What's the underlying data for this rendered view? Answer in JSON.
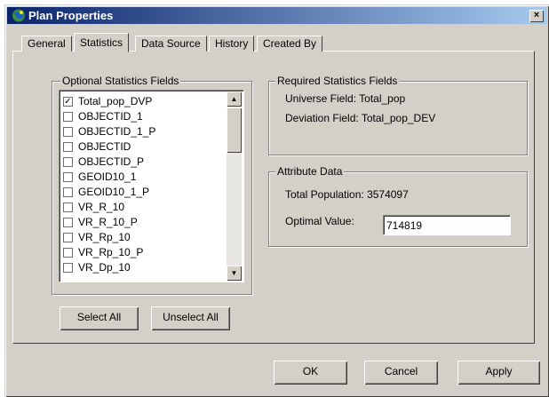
{
  "window": {
    "title": "Plan Properties",
    "close_glyph": "×"
  },
  "tabs": [
    {
      "label": "General"
    },
    {
      "label": "Statistics",
      "active": true
    },
    {
      "label": "Data Source"
    },
    {
      "label": "History"
    },
    {
      "label": "Created By"
    }
  ],
  "optional_stats": {
    "legend": "Optional Statistics Fields",
    "items": [
      {
        "label": "Total_pop_DVP",
        "checked": true,
        "mark": "✓"
      },
      {
        "label": "OBJECTID_1",
        "checked": false
      },
      {
        "label": "OBJECTID_1_P",
        "checked": false
      },
      {
        "label": "OBJECTID",
        "checked": false
      },
      {
        "label": "OBJECTID_P",
        "checked": false
      },
      {
        "label": "GEOID10_1",
        "checked": false
      },
      {
        "label": "GEOID10_1_P",
        "checked": false
      },
      {
        "label": "VR_R_10",
        "checked": false
      },
      {
        "label": "VR_R_10_P",
        "checked": false
      },
      {
        "label": "VR_Rp_10",
        "checked": false
      },
      {
        "label": "VR_Rp_10_P",
        "checked": false
      },
      {
        "label": "VR_Dp_10",
        "checked": false
      }
    ],
    "scroll_up_glyph": "▲",
    "scroll_down_glyph": "▼",
    "select_all_label": "Select All",
    "unselect_all_label": "Unselect All"
  },
  "required_stats": {
    "legend": "Required Statistics Fields",
    "universe_field": "Universe Field: Total_pop",
    "deviation_field": "Deviation Field: Total_pop_DEV"
  },
  "attribute_data": {
    "legend": "Attribute Data",
    "total_population": "Total Population: 3574097",
    "optimal_value_label": "Optimal Value:",
    "optimal_value": "714819"
  },
  "footer": {
    "ok_label": "OK",
    "cancel_label": "Cancel",
    "apply_label": "Apply"
  },
  "colors": {
    "title_start": "#0a246a",
    "title_end": "#a6caf0",
    "face": "#d4d0c8"
  }
}
